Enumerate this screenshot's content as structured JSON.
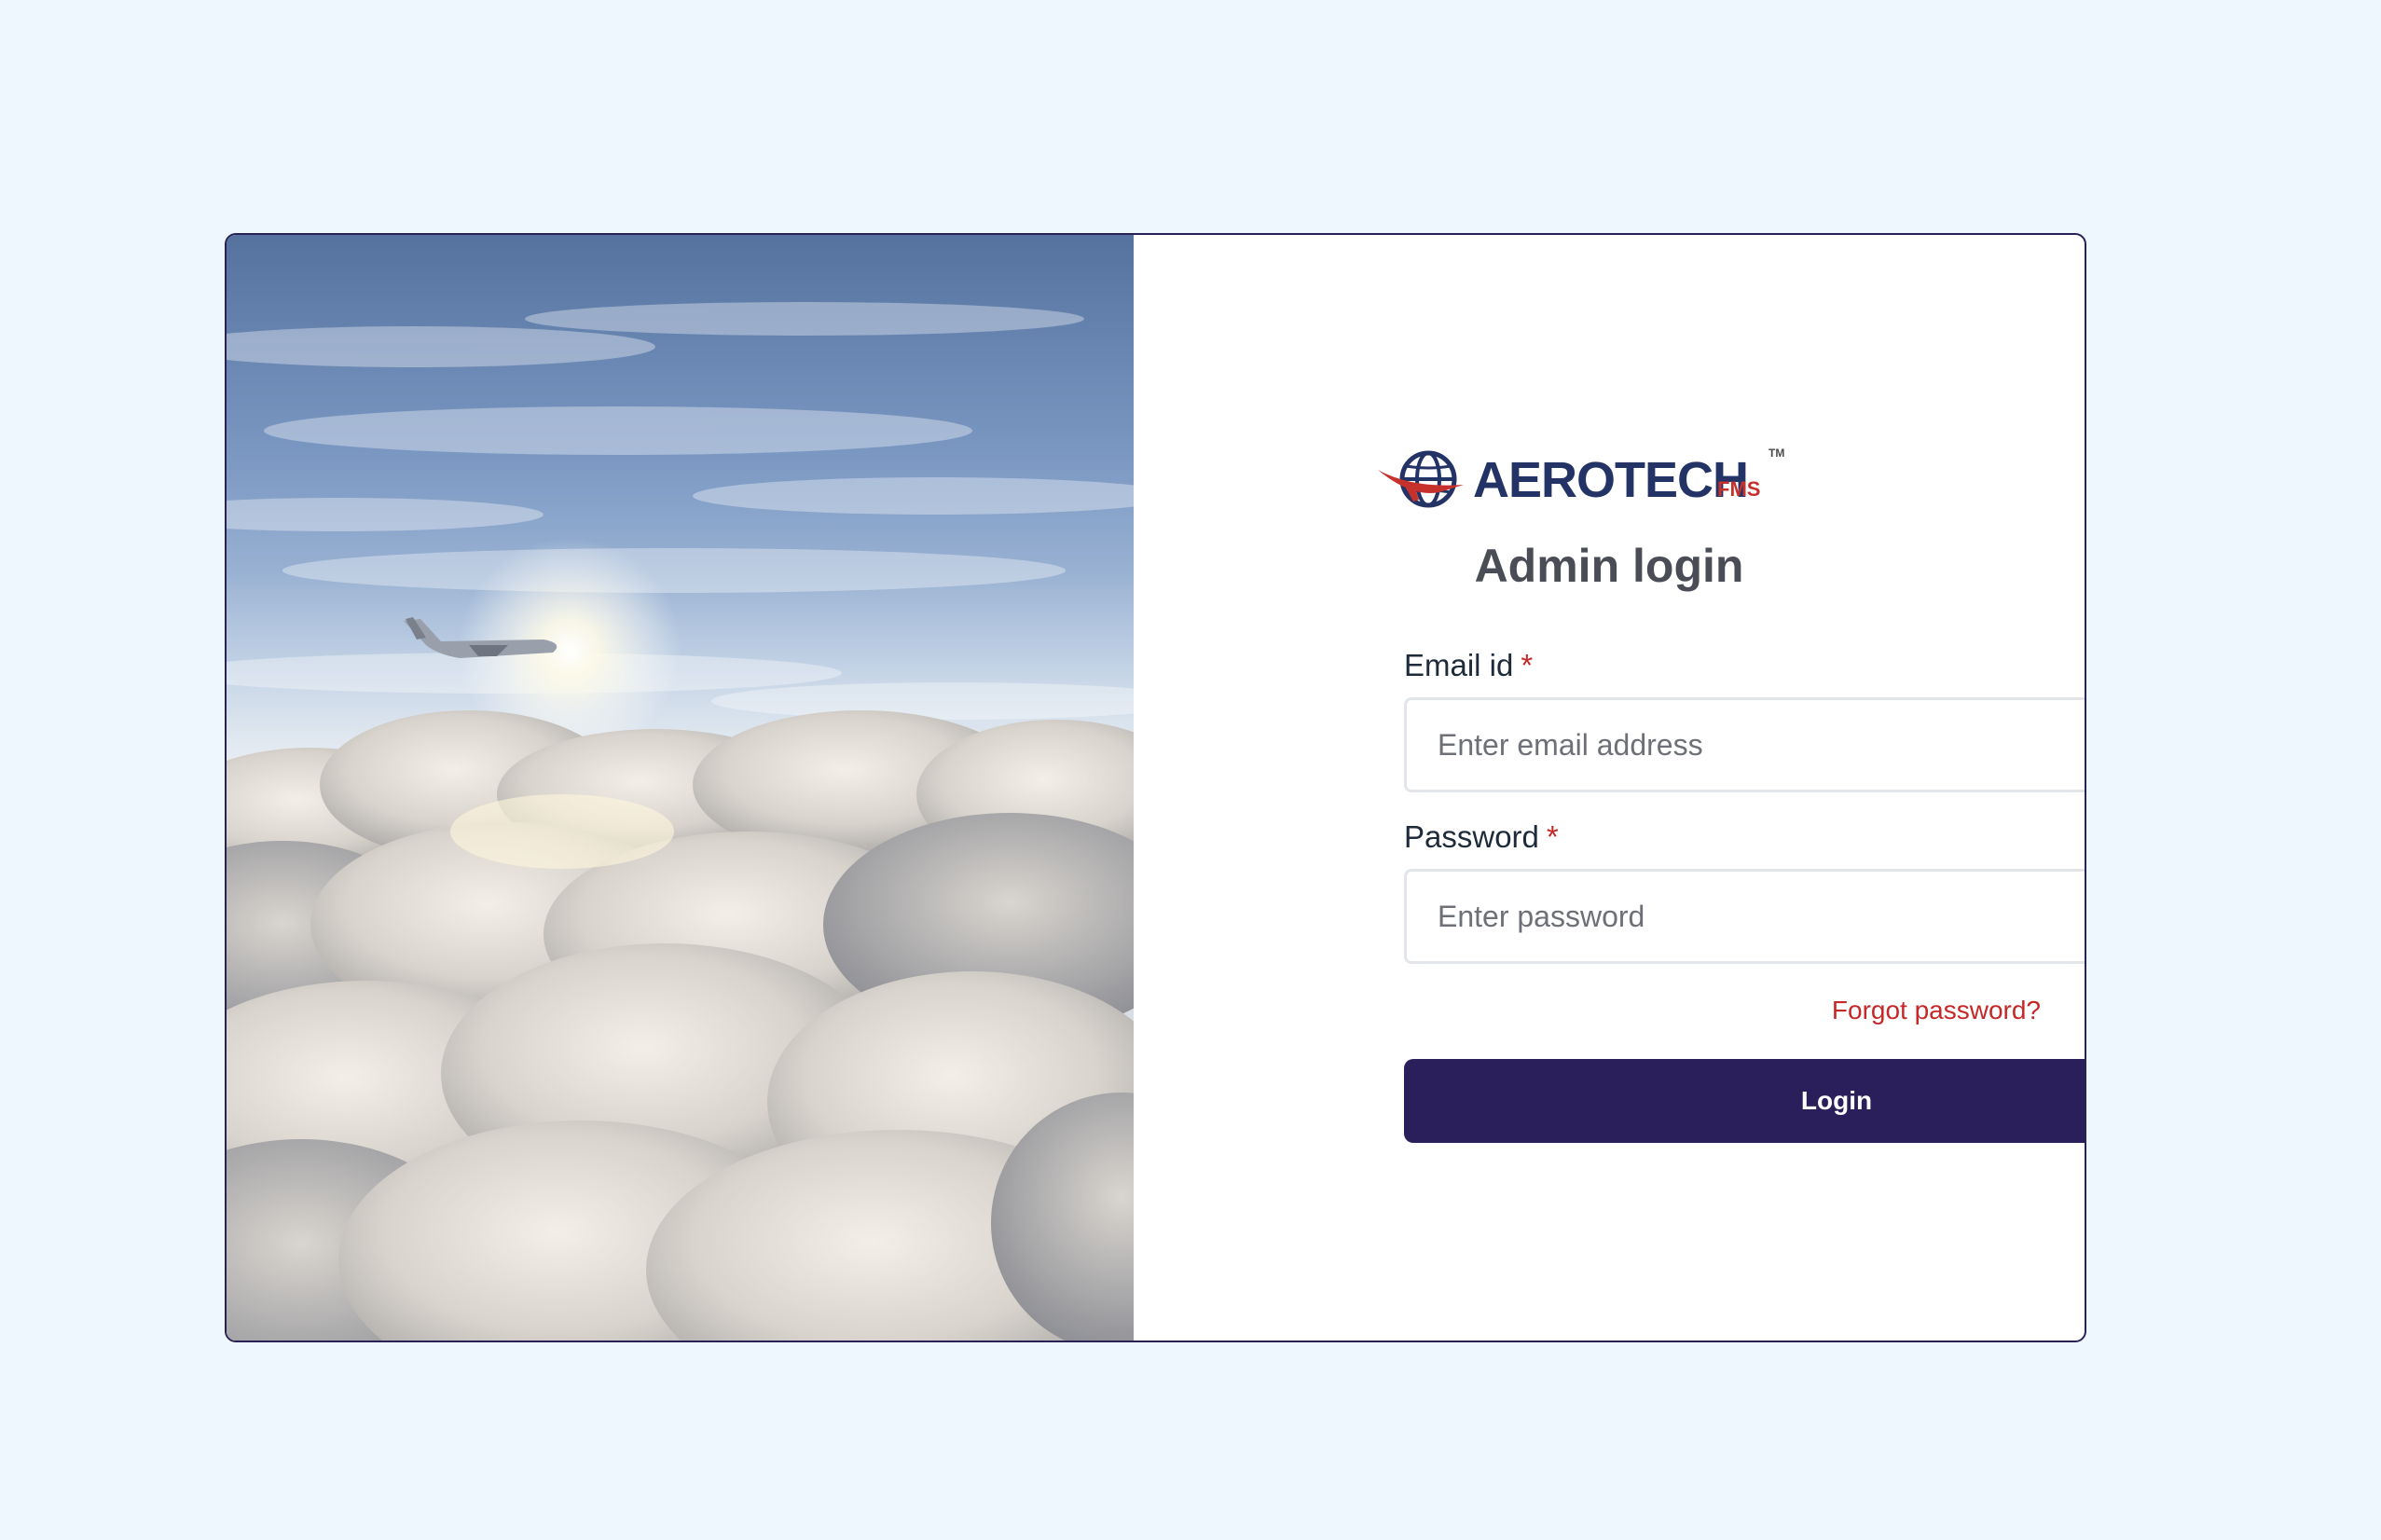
{
  "brand": {
    "name": "AEROTECH",
    "suffix": "FMS",
    "trademark": "TM"
  },
  "form": {
    "title": "Admin login",
    "email": {
      "label": "Email id",
      "required_mark": "*",
      "placeholder": "Enter email address",
      "value": ""
    },
    "password": {
      "label": "Password",
      "required_mark": "*",
      "placeholder": "Enter password",
      "value": ""
    },
    "forgot_password": "Forgot password?",
    "submit_label": "Login"
  },
  "theme": {
    "page_background": "#eef6fe",
    "primary": "#2a1f5a",
    "accent": "#c62828",
    "brand_blue": "#233365"
  },
  "hero": {
    "icon": "airplane-above-clouds-photo"
  }
}
